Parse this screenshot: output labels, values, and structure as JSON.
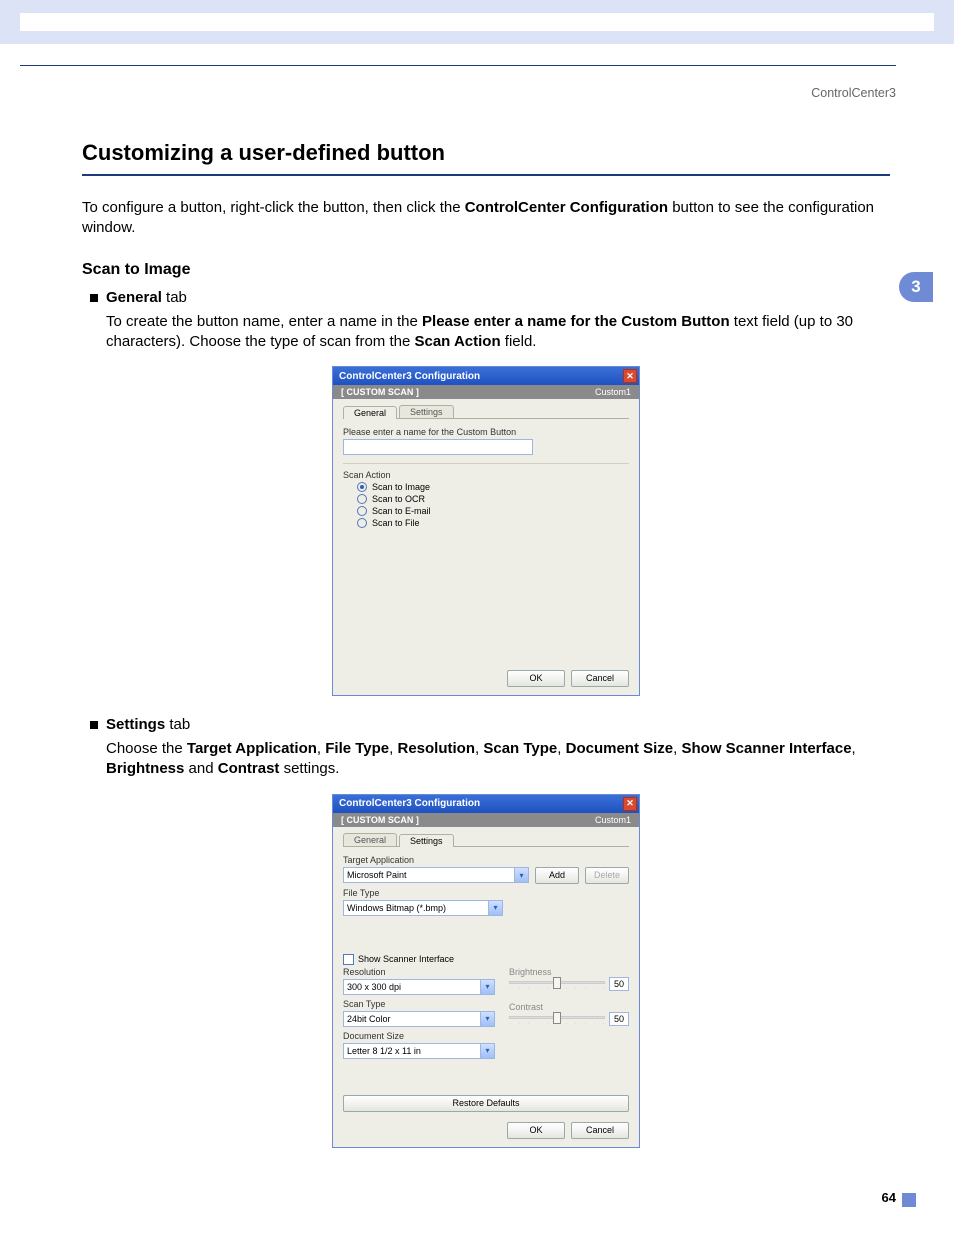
{
  "header": {
    "product": "ControlCenter3"
  },
  "sidebar": {
    "chapter": "3"
  },
  "footer": {
    "page": "64"
  },
  "section": {
    "title": "Customizing a user-defined button",
    "intro_pre": "To configure a button, right-click the button, then click the ",
    "intro_bold": "ControlCenter Configuration",
    "intro_post": " button to see the configuration window.",
    "sub1": "Scan to Image",
    "bullet_general_pre": "General",
    "bullet_general_post": " tab",
    "para1_a": "To create the button name, enter a name in the ",
    "para1_b": "Please enter a name for the Custom Button",
    "para1_c": " text field (up to 30 characters). Choose the type of scan from the ",
    "para1_d": "Scan Action",
    "para1_e": " field.",
    "bullet_settings_pre": "Settings",
    "bullet_settings_post": " tab",
    "para2_a": "Choose the ",
    "para2_b": "Target Application",
    "para2_c": ", ",
    "para2_d": "File Type",
    "para2_e": ", ",
    "para2_f": "Resolution",
    "para2_g": ", ",
    "para2_h": "Scan Type",
    "para2_i": ", ",
    "para2_j": "Document Size",
    "para2_k": ", ",
    "para2_l": "Show Scanner Interface",
    "para2_m": ", ",
    "para2_n": "Brightness",
    "para2_o": " and ",
    "para2_p": "Contrast",
    "para2_q": " settings."
  },
  "dlg1": {
    "title": "ControlCenter3 Configuration",
    "subL": "[  CUSTOM SCAN  ]",
    "subR": "Custom1",
    "tabs": {
      "general": "General",
      "settings": "Settings"
    },
    "name_label": "Please enter a name for the Custom Button",
    "group": "Scan Action",
    "r1": "Scan to Image",
    "r2": "Scan to OCR",
    "r3": "Scan to E-mail",
    "r4": "Scan to File",
    "ok": "OK",
    "cancel": "Cancel"
  },
  "dlg2": {
    "title": "ControlCenter3 Configuration",
    "subL": "[  CUSTOM SCAN  ]",
    "subR": "Custom1",
    "tabs": {
      "general": "General",
      "settings": "Settings"
    },
    "target_label": "Target Application",
    "target_value": "Microsoft Paint",
    "add": "Add",
    "delete": "Delete",
    "filetype_label": "File Type",
    "filetype_value": "Windows Bitmap (*.bmp)",
    "show_scanner": "Show Scanner Interface",
    "res_label": "Resolution",
    "res_value": "300 x 300 dpi",
    "scantype_label": "Scan Type",
    "scantype_value": "24bit Color",
    "docsize_label": "Document Size",
    "docsize_value": "Letter 8 1/2 x 11 in",
    "brightness_label": "Brightness",
    "brightness_value": "50",
    "contrast_label": "Contrast",
    "contrast_value": "50",
    "restore": "Restore Defaults",
    "ok": "OK",
    "cancel": "Cancel"
  }
}
